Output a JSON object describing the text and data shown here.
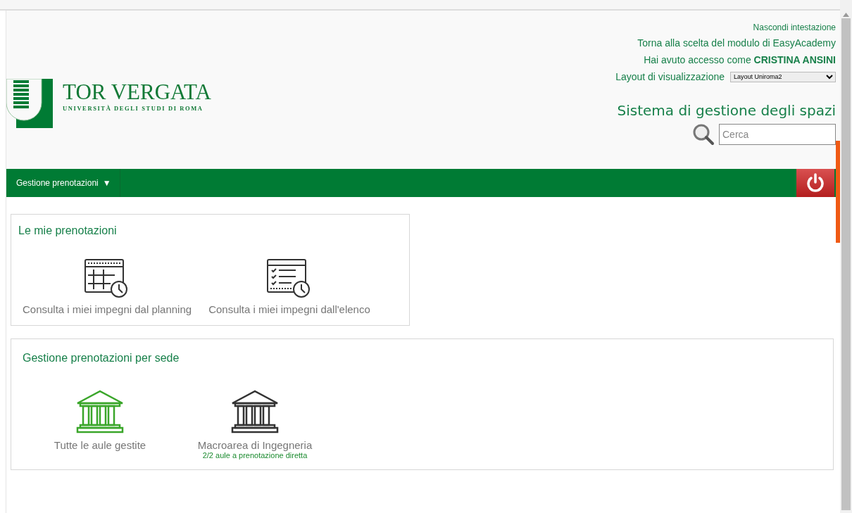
{
  "header": {
    "logo": {
      "title": "TOR VERGATA",
      "subtitle": "UNIVERSITÀ DEGLI STUDI DI ROMA"
    },
    "links": [
      "Nascondi intestazione",
      "Torna alla scelta del modulo di EasyAcademy"
    ],
    "access": "Hai avuto accesso come **CRISTINA ANSINI**",
    "layout_label": "Layout di visualizzazione",
    "layout_value": "Layout Uniroma2",
    "app_title": "Sistema di gestione degli spazi",
    "search": {
      "placeholder": "Cerca"
    }
  },
  "nav": {
    "menu": "Gestione prenotazioni",
    "caret": "▼"
  },
  "panels": [
    {
      "title": "Le mie prenotazioni",
      "items": [
        {
          "kind": "planning",
          "label": "Consulta i miei impegni dal planning",
          "highlighted": false
        },
        {
          "kind": "list",
          "label": "Consulta i miei impegni dall'elenco",
          "highlighted": false
        }
      ]
    },
    {
      "title": "Gestione prenotazioni per sede",
      "items": [
        {
          "kind": "building",
          "label": "Tutte le aule gestite",
          "highlighted": true
        },
        {
          "kind": "building",
          "label": "Macroarea di Ingegneria",
          "note": "2/2 aule a prenotazione diretta",
          "highlighted": false
        }
      ]
    }
  ]
}
